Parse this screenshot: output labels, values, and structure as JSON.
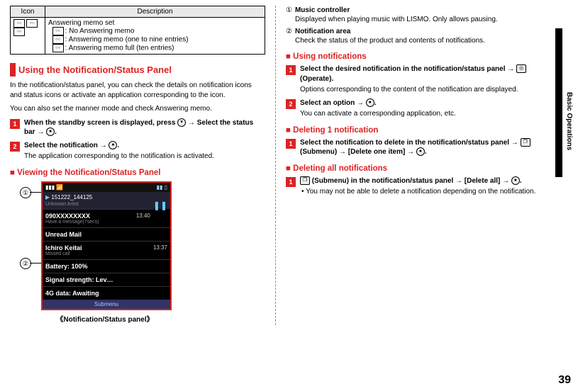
{
  "sideLabel": "Basic Operations",
  "pageNumber": "39",
  "iconTable": {
    "headers": {
      "icon": "Icon",
      "desc": "Description"
    },
    "row": {
      "title": "Answering memo set",
      "line1": ": No Answering memo",
      "line2": ": Answering memo (one to nine entries)",
      "line3": ": Answering memo full (ten entries)"
    }
  },
  "left": {
    "h1": "Using the Notification/Status Panel",
    "p1": "In the notification/status panel, you can check the details on notification icons and status icons or activate an application corresponding to the icon.",
    "p2": "You can also set the manner mode and check Answering memo.",
    "step1a": "When the standby screen is displayed, press ",
    "step1b": " → Select the status bar → ",
    "step1c": ".",
    "step2a": "Select the notification → ",
    "step2b": ".",
    "step2sub": "The application corresponding to the notification is activated.",
    "h2": "Viewing the Notification/Status Panel",
    "caption": "《Notification/Status panel》",
    "phone": {
      "clock": "151222_144125",
      "author": "Unknown Artist",
      "rows": [
        {
          "t": "090XXXXXXXX",
          "s": "Have a message(7secs)",
          "time": "13:40"
        },
        {
          "t": "Unread Mail",
          "s": "",
          "time": ""
        },
        {
          "t": "Ichiro Keitai",
          "s": "Missed call",
          "time": "13:37"
        },
        {
          "t": "Battery: 100%",
          "s": "",
          "time": ""
        },
        {
          "t": "Signal strength: Lev…",
          "s": "",
          "time": ""
        },
        {
          "t": "4G data: Awaiting",
          "s": "",
          "time": ""
        }
      ],
      "soft": "Submenu"
    }
  },
  "right": {
    "items": [
      {
        "num": "①",
        "title": "Music controller",
        "desc": "Displayed when playing music with LISMO. Only allows pausing."
      },
      {
        "num": "②",
        "title": "Notification area",
        "desc": "Check the status of the product and contents of notifications."
      }
    ],
    "h_using": "Using notifications",
    "using_s1a": "Select the desired notification in the notification/status panel → ",
    "using_s1b": " (Operate).",
    "using_s1sub": "Options corresponding to the content of the notification are displayed.",
    "using_s2a": "Select an option → ",
    "using_s2b": ".",
    "using_s2sub": "You can activate a corresponding application, etc.",
    "h_del1": "Deleting 1 notification",
    "del1a": "Select the notification to delete in the notification/status panel → ",
    "del1b": " (Submenu) → [Delete one item] → ",
    "del1c": ".",
    "h_delall": "Deleting all notifications",
    "delall_a": " (Submenu) in the notification/status panel → [Delete all] → ",
    "delall_b": ".",
    "delall_note": "You may not be able to delete a notification depending on the notification."
  }
}
